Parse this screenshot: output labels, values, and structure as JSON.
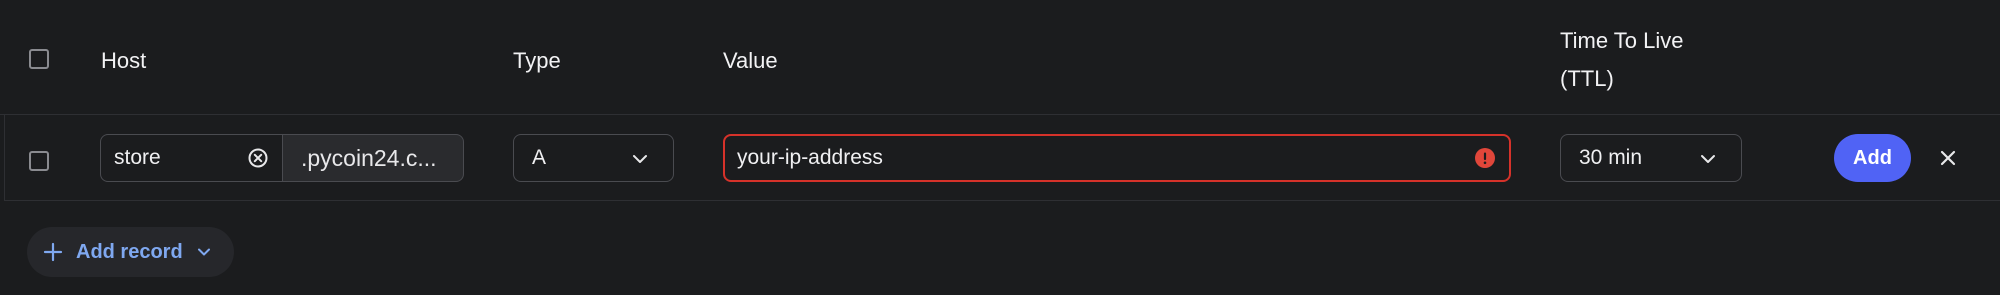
{
  "table": {
    "headers": {
      "host": "Host",
      "type": "Type",
      "value": "Value",
      "ttl_line1": "Time To Live",
      "ttl_line2": "(TTL)"
    }
  },
  "row": {
    "host_value": "store",
    "domain_suffix": ".pycoin24.c...",
    "type_selected": "A",
    "value_text": "your-ip-address",
    "value_state": "error",
    "ttl_selected": "30 min",
    "add_label": "Add"
  },
  "footer": {
    "add_record_label": "Add record"
  },
  "colors": {
    "background": "#1b1c1e",
    "error_border": "#d6322a",
    "primary_button": "#5063f5",
    "link_accent": "#7fa8f0"
  },
  "icons": {
    "clear": "clear-circle-x-icon",
    "error": "exclamation-circle-icon",
    "chevron": "chevron-down-icon",
    "close": "close-x-icon",
    "plus": "plus-icon"
  }
}
